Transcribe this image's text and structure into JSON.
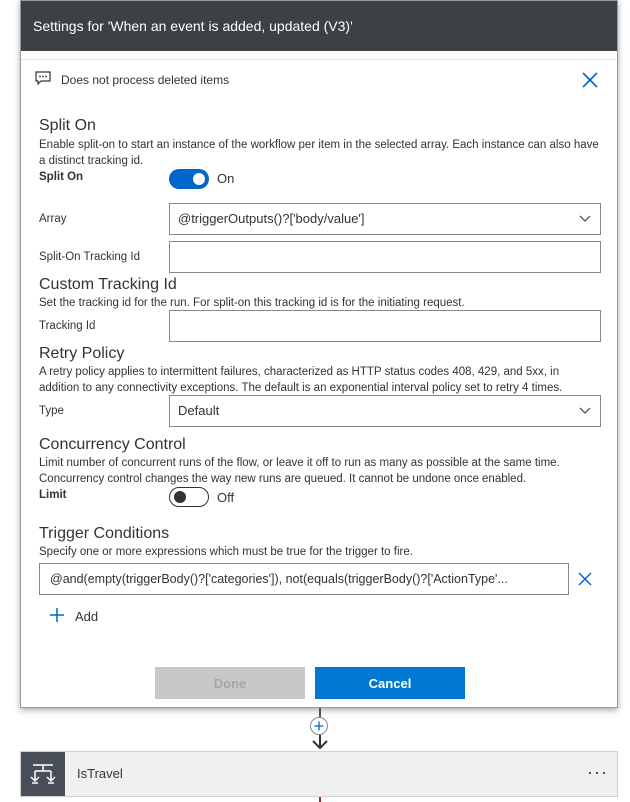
{
  "dialog": {
    "title": "Settings for 'When an event is added, updated (V3)'",
    "note": "Does not process deleted items"
  },
  "split_on": {
    "heading": "Split On",
    "description": "Enable split-on to start an instance of the workflow per item in the selected array. Each instance can also have a distinct tracking id.",
    "toggle_label": "Split On",
    "toggle_state": "On",
    "array_label": "Array",
    "array_value": "@triggerOutputs()?['body/value']",
    "tracking_label": "Split-On Tracking Id",
    "tracking_value": ""
  },
  "custom_tracking": {
    "heading": "Custom Tracking Id",
    "description": "Set the tracking id for the run. For split-on this tracking id is for the initiating request.",
    "label": "Tracking Id",
    "value": ""
  },
  "retry_policy": {
    "heading": "Retry Policy",
    "description": "A retry policy applies to intermittent failures, characterized as HTTP status codes 408, 429, and 5xx, in addition to any connectivity exceptions. The default is an exponential interval policy set to retry 4 times.",
    "type_label": "Type",
    "type_value": "Default"
  },
  "concurrency": {
    "heading": "Concurrency Control",
    "description": "Limit number of concurrent runs of the flow, or leave it off to run as many as possible at the same time. Concurrency control changes the way new runs are queued. It cannot be undone once enabled.",
    "limit_label": "Limit",
    "toggle_state": "Off"
  },
  "trigger_conditions": {
    "heading": "Trigger Conditions",
    "description": "Specify one or more expressions which must be true for the trigger to fire.",
    "condition_value": "@and(empty(triggerBody()?['categories']), not(equals(triggerBody()?['ActionType'...",
    "add_label": "Add"
  },
  "buttons": {
    "done": "Done",
    "cancel": "Cancel"
  },
  "next_step": {
    "title": "IsTravel",
    "more": "···"
  },
  "colors": {
    "titlebar": "#3b4145",
    "accent": "#0078d4",
    "close_icon": "#0066cc"
  }
}
